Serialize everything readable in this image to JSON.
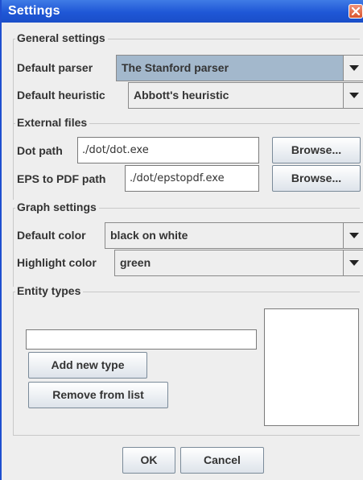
{
  "window": {
    "title": "Settings"
  },
  "general": {
    "title": "General settings",
    "parser_label": "Default parser",
    "parser_value": "The Stanford parser",
    "heuristic_label": "Default heuristic",
    "heuristic_value": "Abbott's heuristic"
  },
  "external": {
    "title": "External files",
    "dot_label": "Dot path",
    "dot_value": "./dot/dot.exe",
    "eps_label": "EPS to PDF path",
    "eps_value": "./dot/epstopdf.exe",
    "browse_label": "Browse..."
  },
  "graph": {
    "title": "Graph settings",
    "color_label": "Default color",
    "color_value": "black on white",
    "highlight_label": "Highlight color",
    "highlight_value": "green"
  },
  "entity": {
    "title": "Entity types",
    "new_type_value": "",
    "add_label": "Add new type",
    "remove_label": "Remove from list"
  },
  "footer": {
    "ok_label": "OK",
    "cancel_label": "Cancel"
  },
  "colors": {
    "titlebar": "#1f57d6",
    "selected_combo": "#a3b8cc",
    "panel": "#eeeeee"
  },
  "icons": {
    "close": "close-icon",
    "dropdown": "chevron-down-icon"
  }
}
